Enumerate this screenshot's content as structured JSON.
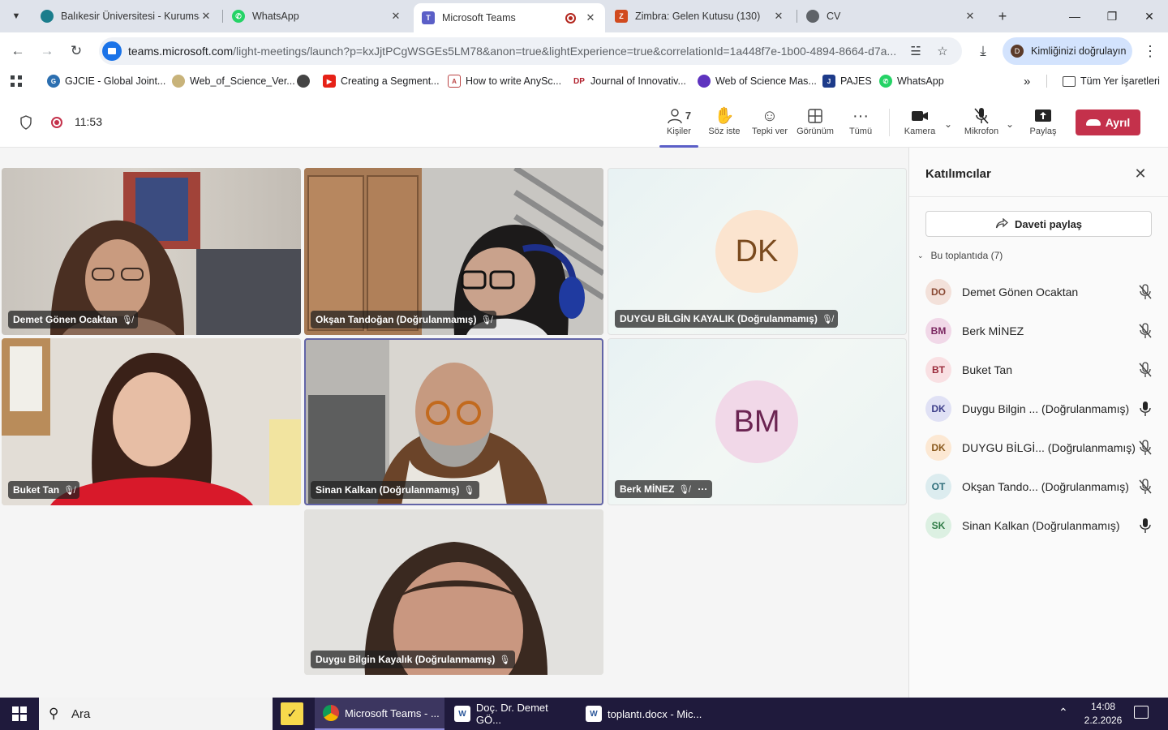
{
  "browser": {
    "tabs": [
      {
        "title": "Balıkesir Üniversitesi - Kurumsa",
        "favicon_color": "#1b7d8c"
      },
      {
        "title": "WhatsApp",
        "favicon_color": "#25d366"
      },
      {
        "title": "Microsoft Teams",
        "favicon_color": "#5b5fc7",
        "active": true
      },
      {
        "title": "Zimbra: Gelen Kutusu (130)",
        "favicon_color": "#d14a1e"
      },
      {
        "title": "CV",
        "favicon_color": "#5f6368"
      }
    ],
    "url_host": "teams.microsoft.com",
    "url_path": "/light-meetings/launch?p=kxJjtPCgWSGEs5LM78&anon=true&lightExperience=true&correlationId=1a448f7e-1b00-4894-8664-d7a...",
    "profile_label": "Kimliğinizi doğrulayın",
    "profile_initial": "D",
    "bookmarks": [
      "GJCIE - Global Joint...",
      "Web_of_Science_Ver...",
      "",
      "Creating a Segment...",
      "How to write AnySc...",
      "Journal of Innovativ...",
      "Web of Science Mas...",
      "PAJES",
      "WhatsApp"
    ],
    "all_bookmarks": "Tüm Yer İşaretleri"
  },
  "teams": {
    "timer": "11:53",
    "toolbar": {
      "people_label": "Kişiler",
      "people_count": "7",
      "raise_label": "Söz iste",
      "react_label": "Tepki ver",
      "view_label": "Görünüm",
      "more_label": "Tümü",
      "camera_label": "Kamera",
      "mic_label": "Mikrofon",
      "share_label": "Paylaş",
      "leave_label": "Ayrıl"
    },
    "tiles": [
      {
        "name": "Demet Gönen Ocaktan"
      },
      {
        "name": "Okşan Tandoğan (Doğrulanmamış)"
      },
      {
        "name": "DUYGU BİLGİN KAYALIK (Doğrulanmamış)",
        "initials": "DK",
        "avatar_color": "#fbe4cf",
        "initials_color": "#7a4a1e"
      },
      {
        "name": "Buket Tan"
      },
      {
        "name": "Sinan Kalkan (Doğrulanmamış)"
      },
      {
        "name": "Berk MİNEZ",
        "initials": "BM",
        "avatar_color": "#f1d8e8",
        "initials_color": "#6b2552"
      },
      {
        "name": "Duygu Bilgin Kayalık (Doğrulanmamış)"
      }
    ],
    "panel": {
      "title": "Katılımcılar",
      "invite_label": "Daveti paylaş",
      "section_label": "Bu toplantıda (7)",
      "participants": [
        {
          "initials": "DO",
          "name": "Demet Gönen Ocaktan",
          "bg": "#f3e1da",
          "fg": "#8a4a35",
          "mic": "muted"
        },
        {
          "initials": "BM",
          "name": "Berk MİNEZ",
          "bg": "#f1d8e8",
          "fg": "#7a2760",
          "mic": "muted"
        },
        {
          "initials": "BT",
          "name": "Buket Tan",
          "bg": "#f9e0e3",
          "fg": "#9a2a3a",
          "mic": "muted"
        },
        {
          "initials": "DK",
          "name": "Duygu Bilgin ...  (Doğrulanmamış)",
          "bg": "#e0e1f5",
          "fg": "#3e3f8a",
          "mic": "on"
        },
        {
          "initials": "DK",
          "name": "DUYGU BİLGİ...  (Doğrulanmamış)",
          "bg": "#fce8d3",
          "fg": "#8a5a1e",
          "mic": "muted"
        },
        {
          "initials": "OT",
          "name": "Okşan Tando...  (Doğrulanmamış)",
          "bg": "#dcecef",
          "fg": "#2e6e7a",
          "mic": "muted"
        },
        {
          "initials": "SK",
          "name": "Sinan Kalkan (Doğrulanmamış)",
          "bg": "#dcf0e2",
          "fg": "#2e7a45",
          "mic": "on"
        }
      ]
    }
  },
  "taskbar": {
    "search_placeholder": "Ara",
    "apps": [
      {
        "label": "Microsoft Teams - ...",
        "active": true
      },
      {
        "label": "Doç. Dr. Demet GÖ..."
      },
      {
        "label": "toplantı.docx - Mic..."
      }
    ],
    "time": "14:08",
    "date": "2.2.2026"
  }
}
